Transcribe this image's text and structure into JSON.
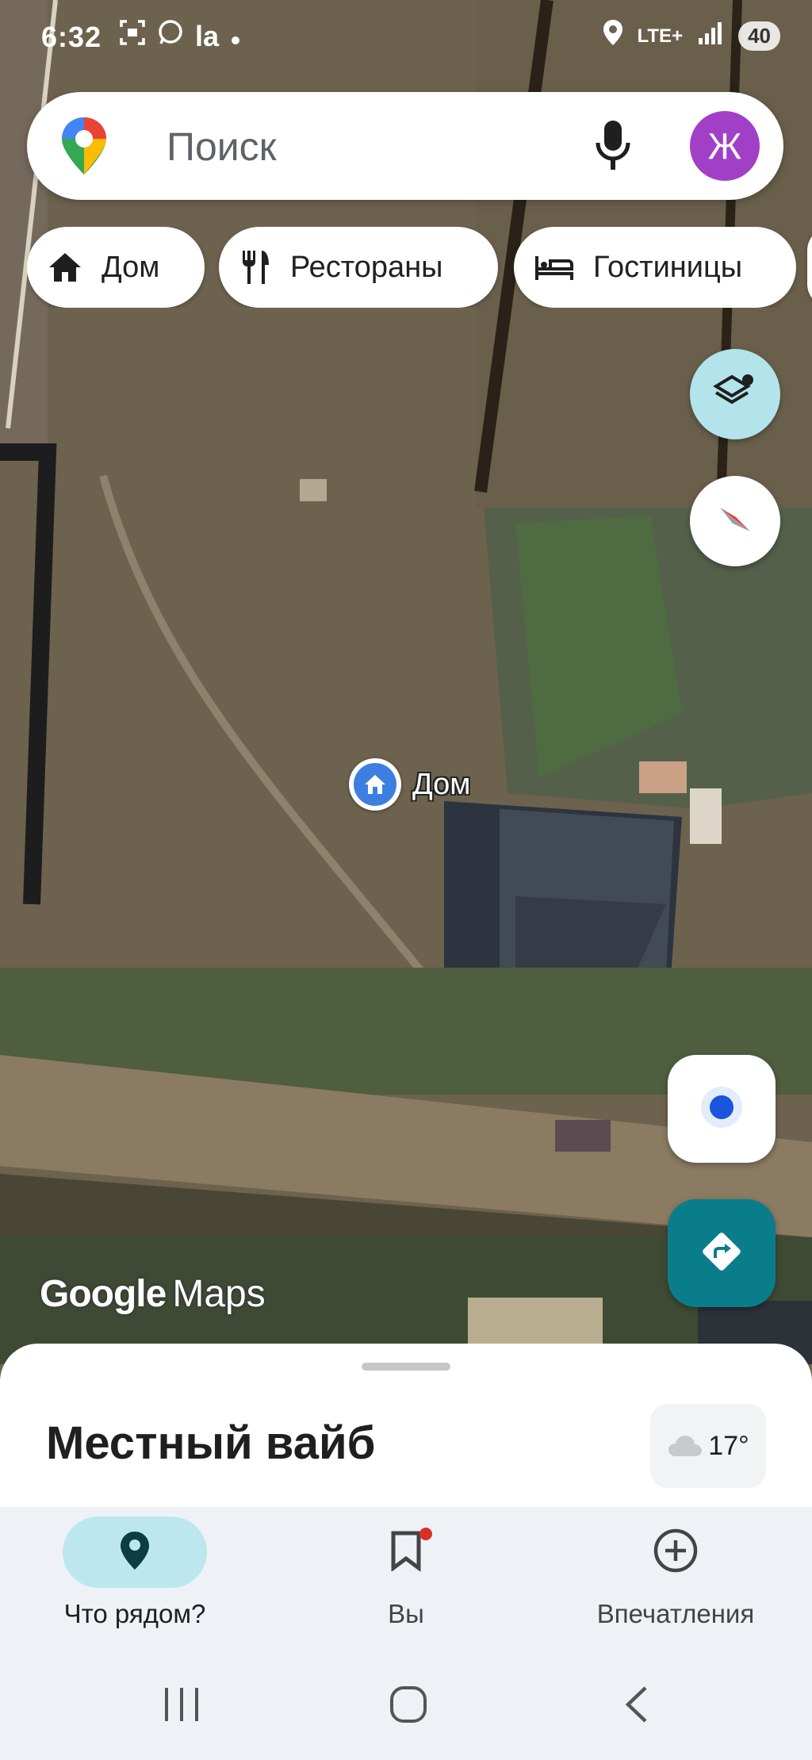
{
  "status_bar": {
    "time": "6:32",
    "network": "LTE+",
    "battery": "40"
  },
  "search": {
    "placeholder": "Поиск",
    "avatar_letter": "Ж"
  },
  "chips": [
    {
      "label": "Дом",
      "icon": "home-icon"
    },
    {
      "label": "Рестораны",
      "icon": "restaurant-icon"
    },
    {
      "label": "Гостиницы",
      "icon": "hotel-icon"
    }
  ],
  "map": {
    "place_label": "Дом",
    "logo_google": "Google",
    "logo_maps": "Maps"
  },
  "sheet": {
    "title": "Местный вайб",
    "weather_temp": "17°",
    "weather_icon": "cloud-icon"
  },
  "bottom_nav": {
    "items": [
      {
        "label": "Что рядом?",
        "icon": "explore-pin-icon",
        "active": true
      },
      {
        "label": "Вы",
        "icon": "bookmark-icon",
        "active": false
      },
      {
        "label": "Впечатления",
        "icon": "add-circle-icon",
        "active": false
      }
    ]
  },
  "colors": {
    "accent": "#0a7d8a",
    "active_nav_bg": "#bde7ef",
    "avatar_bg": "#a23fc7",
    "home_pin": "#3d7fe0",
    "notification_dot": "#d93025"
  }
}
